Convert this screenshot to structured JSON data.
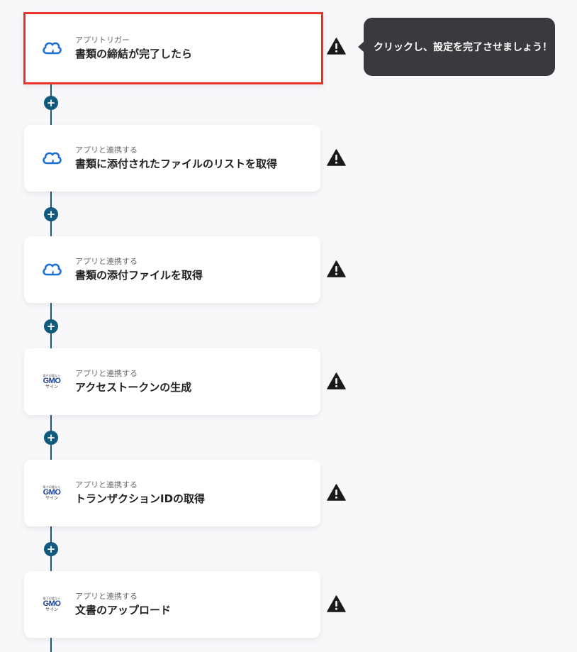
{
  "steps": [
    {
      "kind": "アプリトリガー",
      "title": "書類の締結が完了したら",
      "app": "cloud-sign",
      "selected": true
    },
    {
      "kind": "アプリと連携する",
      "title": "書類に添付されたファイルのリストを取得",
      "app": "cloud-sign"
    },
    {
      "kind": "アプリと連携する",
      "title": "書類の添付ファイルを取得",
      "app": "cloud-sign"
    },
    {
      "kind": "アプリと連携する",
      "title": "アクセストークンの生成",
      "app": "gmo-sign"
    },
    {
      "kind": "アプリと連携する",
      "title": "トランザクションIDの取得",
      "app": "gmo-sign"
    },
    {
      "kind": "アプリと連携する",
      "title": "文書のアップロード",
      "app": "gmo-sign"
    }
  ],
  "gmo_logo": {
    "top": "電子印鑑なら",
    "mid": "GMO",
    "bot": "サイン"
  },
  "tooltip": {
    "text": "クリックし、設定を完了させましょう！"
  },
  "add_step_glyph": "+",
  "colors": {
    "accent": "#0f5a7d",
    "selection": "#e8352a",
    "cloud": "#1b6fd1",
    "tooltip_bg": "#3a3a3e"
  },
  "icons": {
    "warning": "warning-icon",
    "cloud_sign": "cloud-sign-icon",
    "gmo_sign": "gmo-sign-logo",
    "add": "plus-icon"
  }
}
